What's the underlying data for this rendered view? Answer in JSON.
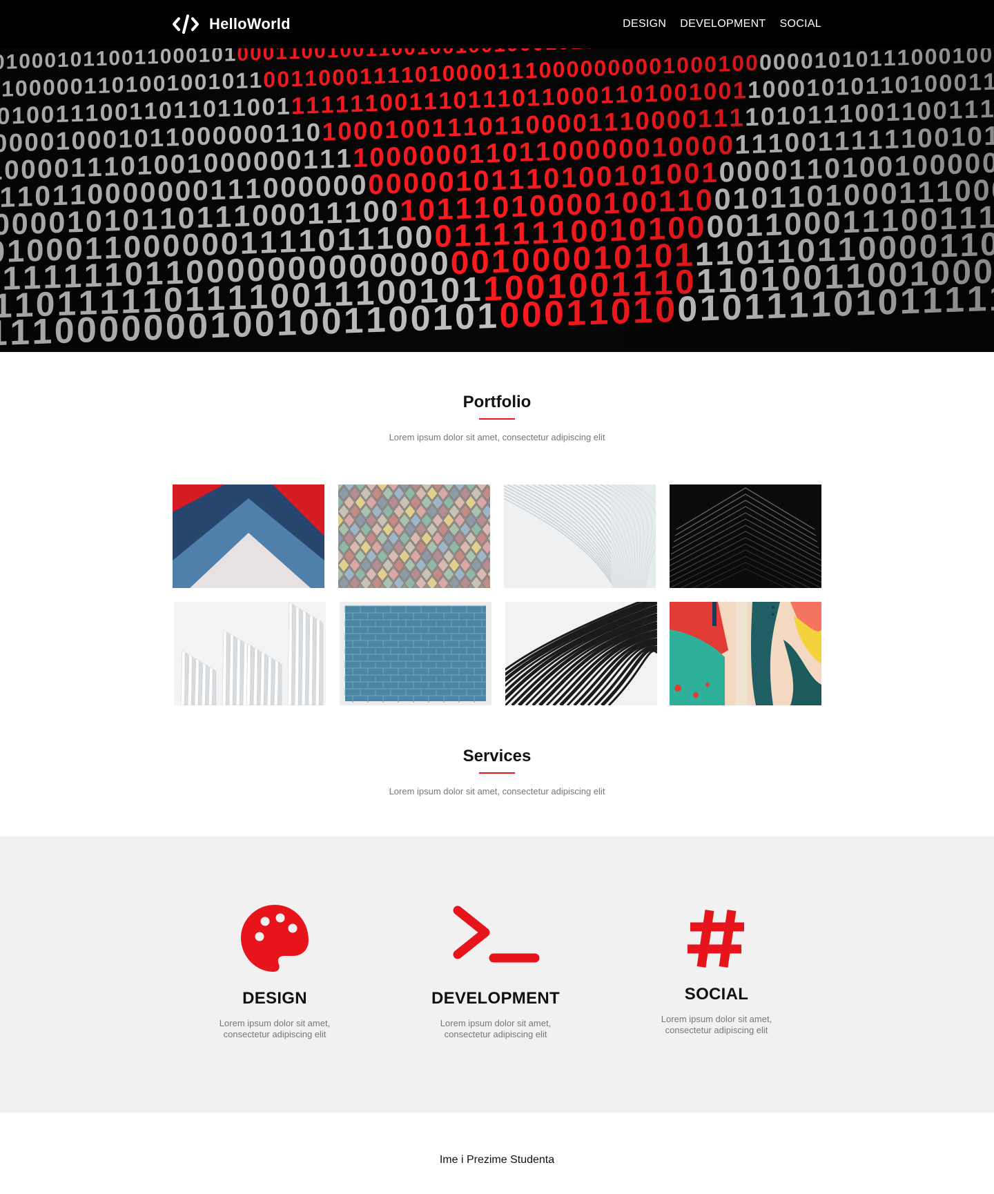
{
  "header": {
    "brand_name": "HelloWorld",
    "logo_icon": "code-brackets-icon",
    "nav": [
      {
        "label": "DESIGN"
      },
      {
        "label": "DEVELOPMENT"
      },
      {
        "label": "SOCIAL"
      }
    ]
  },
  "hero": {
    "image": "binary-code-red-white-photo"
  },
  "portfolio": {
    "title": "Portfolio",
    "subtitle": "Lorem ipsum dolor sit amet, consectetur adipiscing elit",
    "images": [
      "red-blue-chevron-paper",
      "pastel-diamond-tiles",
      "white-curved-architecture",
      "black-chevron-building",
      "white-fins-architecture",
      "blue-brick-wall",
      "black-white-wave-facade",
      "colorful-abstract-painting"
    ]
  },
  "services": {
    "title": "Services",
    "subtitle": "Lorem ipsum dolor sit amet, consectetur adipiscing elit",
    "items": [
      {
        "icon": "palette-icon",
        "title": "DESIGN",
        "text": "Lorem ipsum dolor sit amet, consectetur adipiscing elit"
      },
      {
        "icon": "terminal-icon",
        "title": "DEVELOPMENT",
        "text": "Lorem ipsum dolor sit amet, consectetur adipiscing elit"
      },
      {
        "icon": "hashtag-icon",
        "title": "SOCIAL",
        "text": "Lorem ipsum dolor sit amet, consectetur adipiscing elit"
      }
    ]
  },
  "footer": {
    "credit": "Ime i Prezime Studenta"
  },
  "colors": {
    "accent": "#e8141c",
    "header_bg": "#000000",
    "services_bg": "#f1f1f1",
    "muted_text": "#777777"
  }
}
